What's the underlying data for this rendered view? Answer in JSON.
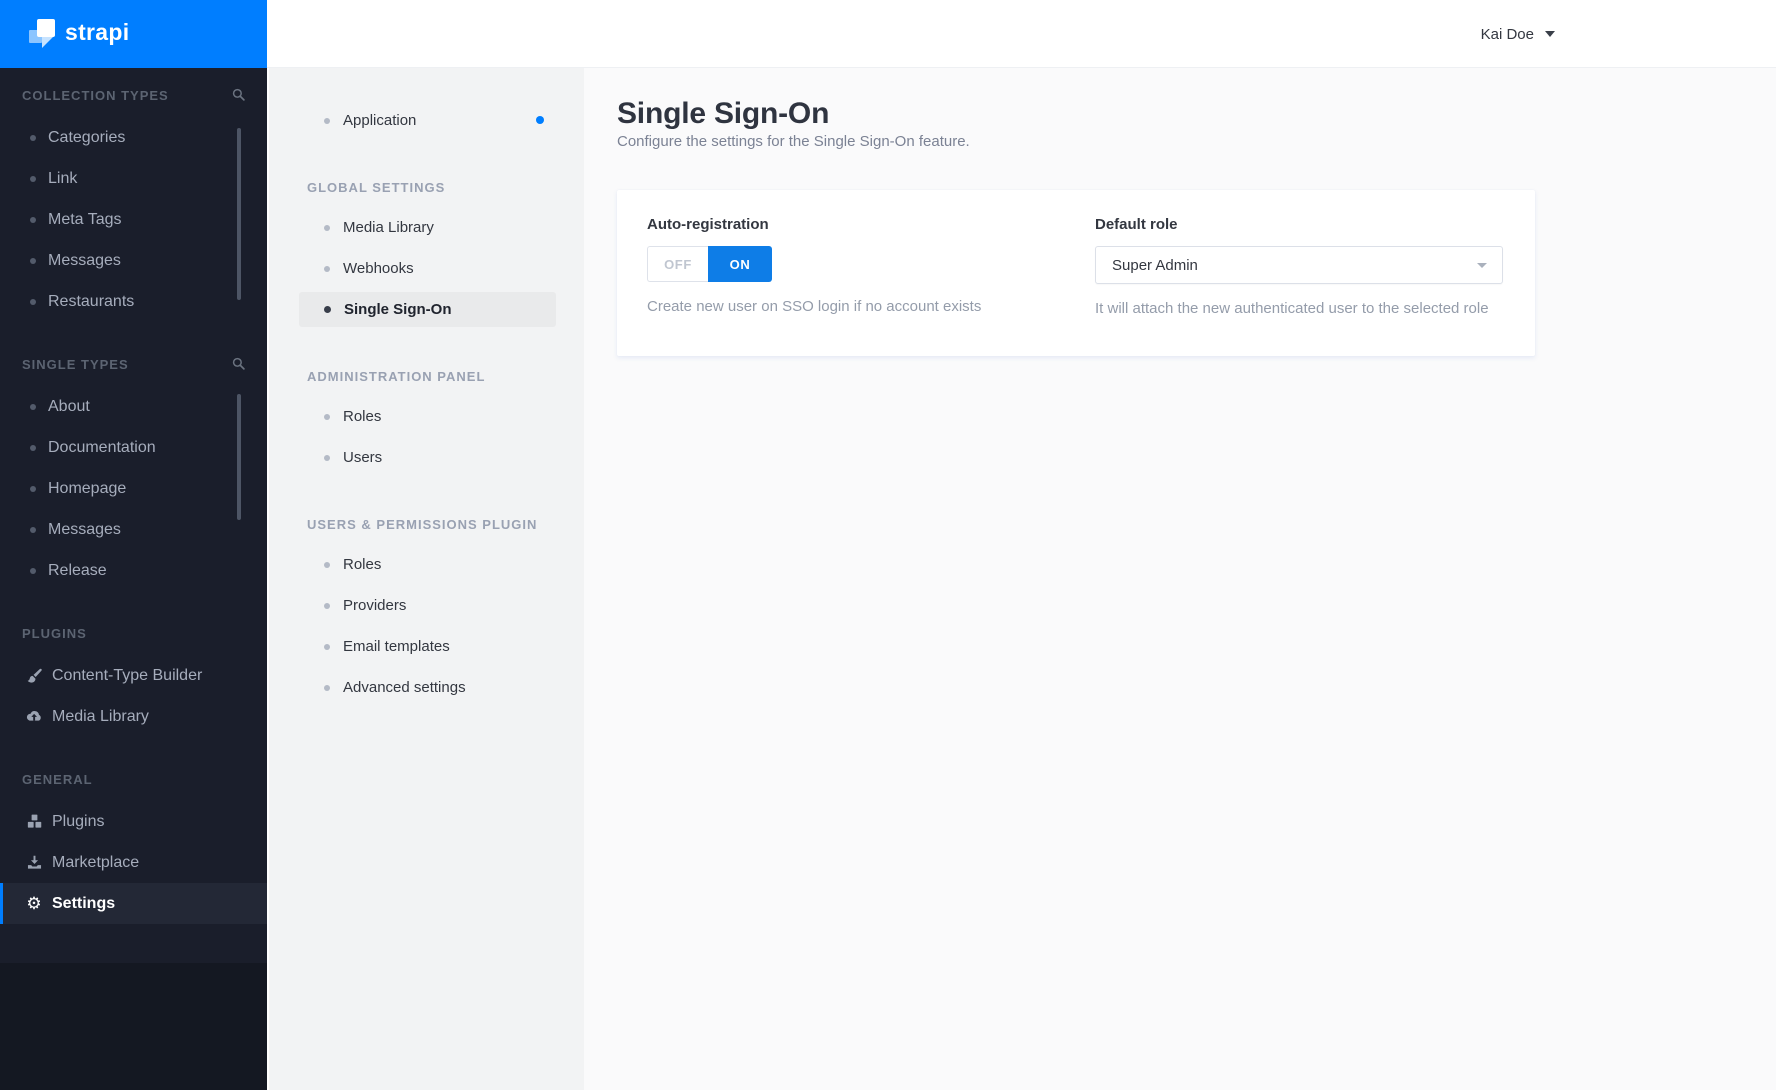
{
  "brand": {
    "name": "strapi"
  },
  "topbar": {
    "user_name": "Kai Doe",
    "caret_icon": "chevron-down-icon"
  },
  "colors": {
    "primary": "#007eff",
    "toggle_on": "#0e7de7",
    "sidebar_bg": "#1a1e2b",
    "subnav_bg": "#f2f3f4",
    "content_bg": "#fafafb"
  },
  "sidebar": {
    "sections": [
      {
        "label": "COLLECTION TYPES",
        "search_icon": "search-icon",
        "items": [
          {
            "label": "Categories"
          },
          {
            "label": "Link"
          },
          {
            "label": "Meta Tags"
          },
          {
            "label": "Messages"
          },
          {
            "label": "Restaurants"
          }
        ]
      },
      {
        "label": "SINGLE TYPES",
        "search_icon": "search-icon",
        "items": [
          {
            "label": "About"
          },
          {
            "label": "Documentation"
          },
          {
            "label": "Homepage"
          },
          {
            "label": "Messages"
          },
          {
            "label": "Release"
          }
        ]
      },
      {
        "label": "PLUGINS",
        "items": [
          {
            "label": "Content-Type Builder",
            "icon": "paint-brush-icon"
          },
          {
            "label": "Media Library",
            "icon": "cloud-upload-icon"
          }
        ]
      },
      {
        "label": "GENERAL",
        "items": [
          {
            "label": "Plugins",
            "icon": "cubes-icon"
          },
          {
            "label": "Marketplace",
            "icon": "download-icon"
          },
          {
            "label": "Settings",
            "icon": "gear-icon",
            "active": true
          }
        ]
      }
    ]
  },
  "subnav": {
    "top_items": [
      {
        "label": "Application",
        "notification_dot": true
      }
    ],
    "sections": [
      {
        "label": "GLOBAL SETTINGS",
        "items": [
          {
            "label": "Media Library"
          },
          {
            "label": "Webhooks"
          },
          {
            "label": "Single Sign-On",
            "active": true
          }
        ]
      },
      {
        "label": "ADMINISTRATION PANEL",
        "items": [
          {
            "label": "Roles"
          },
          {
            "label": "Users"
          }
        ]
      },
      {
        "label": "USERS & PERMISSIONS PLUGIN",
        "items": [
          {
            "label": "Roles"
          },
          {
            "label": "Providers"
          },
          {
            "label": "Email templates"
          },
          {
            "label": "Advanced settings"
          }
        ]
      }
    ]
  },
  "main": {
    "title": "Single Sign-On",
    "subtitle": "Configure the settings for the Single Sign-On feature.",
    "form": {
      "auto_registration": {
        "label": "Auto-registration",
        "off_label": "OFF",
        "on_label": "ON",
        "value": "ON",
        "hint": "Create new user on SSO login if no account exists"
      },
      "default_role": {
        "label": "Default role",
        "value": "Super Admin",
        "hint": "It will attach the new authenticated user to the selected role"
      }
    }
  }
}
